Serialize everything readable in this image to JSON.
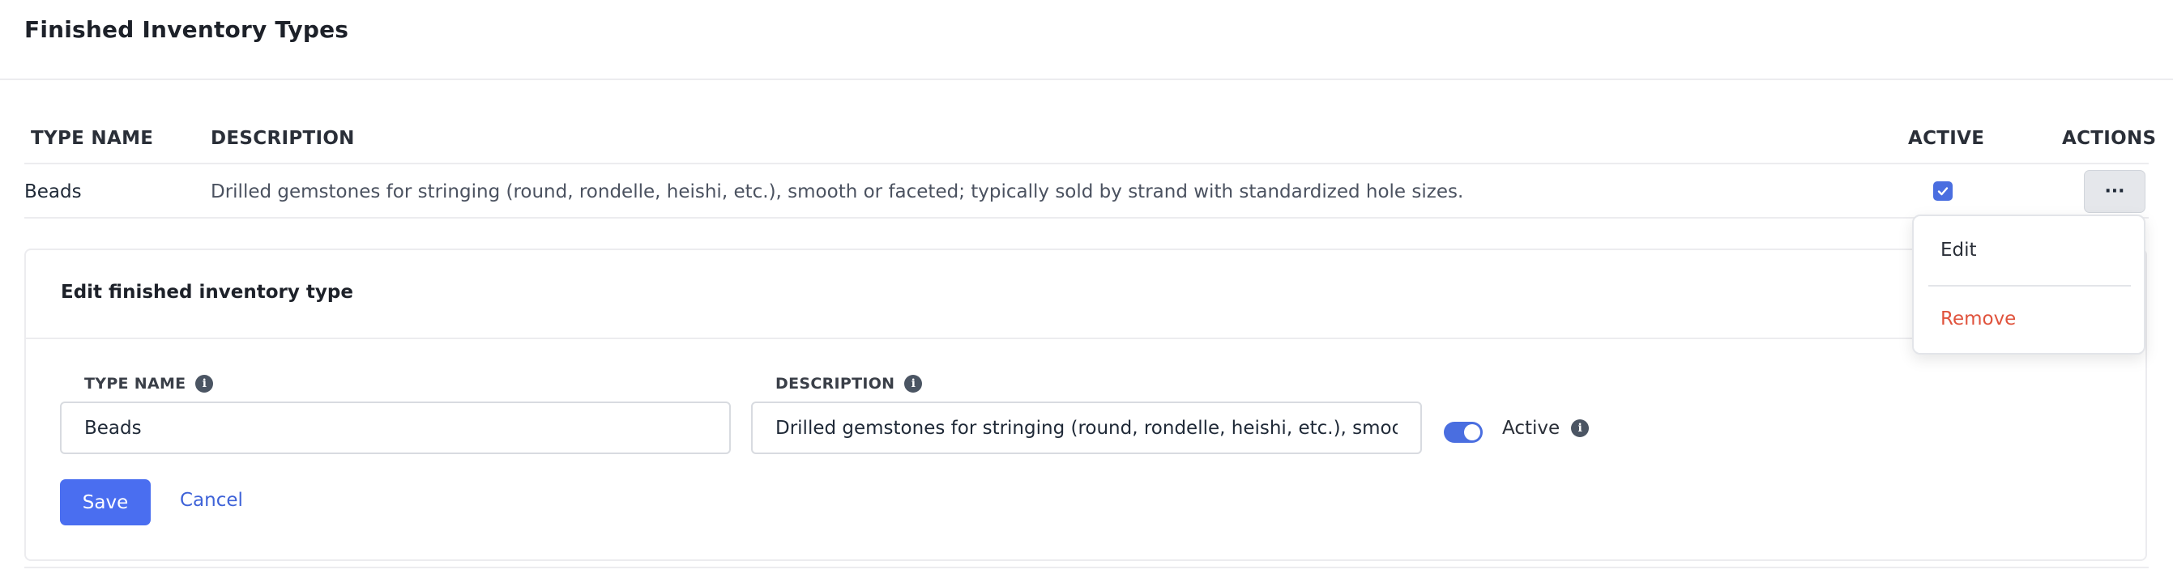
{
  "page": {
    "title": "Finished Inventory Types"
  },
  "table": {
    "columns": {
      "name": "TYPE NAME",
      "description": "DESCRIPTION",
      "active": "ACTIVE",
      "actions": "ACTIONS"
    },
    "rows": [
      {
        "name": "Beads",
        "description": "Drilled gemstones for stringing (round, rondelle, heishi, etc.), smooth or faceted; typically sold by strand with standardized hole sizes.",
        "active": true,
        "actions_label": "···"
      }
    ]
  },
  "dropdown": {
    "items": {
      "edit": "Edit",
      "remove": "Remove"
    }
  },
  "edit_form": {
    "title": "Edit finished inventory type",
    "type_name_label": "TYPE NAME",
    "type_name_value": "Beads",
    "description_label": "DESCRIPTION",
    "description_value": "Drilled gemstones for stringing (round, rondelle, heishi, etc.), smooth or faceted; typically sold by strand with standardized hole sizes.",
    "active_label": "Active",
    "active": true,
    "save_label": "Save",
    "cancel_label": "Cancel"
  },
  "icons": {
    "info": "info-icon",
    "check": "check-icon",
    "more": "more-horizontal-icon"
  },
  "colors": {
    "primary": "#4a6ef0",
    "danger": "#e0533d",
    "link": "#3f63d8"
  }
}
